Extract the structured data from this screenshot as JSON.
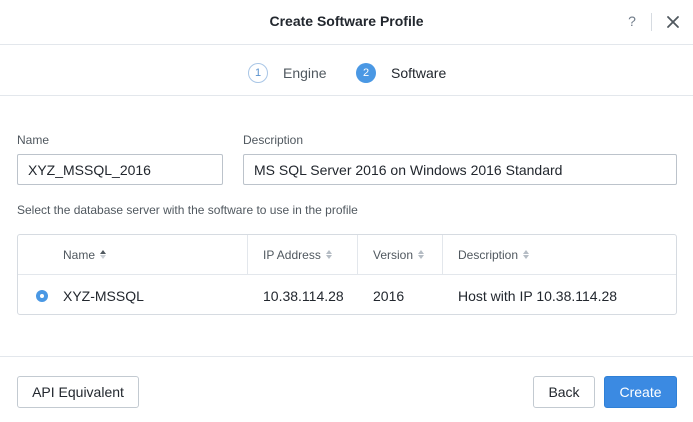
{
  "dialog": {
    "title": "Create Software Profile",
    "help_label": "?",
    "close_icon": "close-icon"
  },
  "steps": [
    {
      "number": "1",
      "label": "Engine",
      "state": "inactive"
    },
    {
      "number": "2",
      "label": "Software",
      "state": "active"
    }
  ],
  "form": {
    "name_label": "Name",
    "name_value": "XYZ_MSSQL_2016",
    "description_label": "Description",
    "description_value": "MS SQL Server 2016 on Windows 2016 Standard",
    "instruction": "Select the database server with the software to use in the profile"
  },
  "table": {
    "columns": [
      "Name",
      "IP Address",
      "Version",
      "Description"
    ],
    "rows": [
      {
        "selected": true,
        "name": "XYZ-MSSQL",
        "ip": "10.38.114.28",
        "version": "2016",
        "description": "Host with IP 10.38.114.28"
      }
    ]
  },
  "footer": {
    "api_label": "API Equivalent",
    "back_label": "Back",
    "create_label": "Create"
  },
  "colors": {
    "accent": "#3b8ae2",
    "text": "#22272e",
    "muted": "#50585f",
    "border": "#d6dbe1"
  }
}
